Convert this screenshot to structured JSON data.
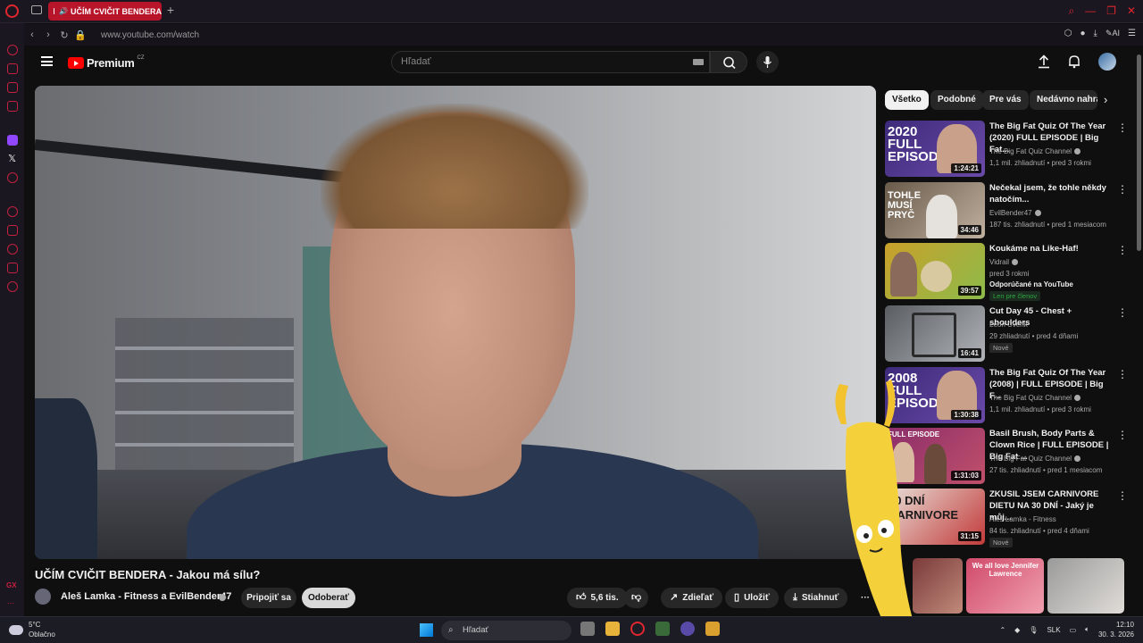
{
  "browser": {
    "tab_title": "UČÍM CVIČIT BENDERA",
    "url": "www.youtube.com/watch",
    "ai_label": "AI",
    "sidebar_more": "...",
    "sidebar_gx": "GX"
  },
  "yt_header": {
    "logo_text": "Premium",
    "logo_region": "CZ",
    "search_placeholder": "Hľadať"
  },
  "video": {
    "title": "UČÍM CVIČIT BENDERA - Jakou má sílu?",
    "channel": "Aleš Lamka - Fitness a EvilBender47",
    "join_label": "Pripojiť sa",
    "subscribe_label": "Odoberať",
    "likes": "5,6 tis.",
    "share_label": "Zdieľať",
    "save_label": "Uložiť",
    "download_label": "Stiahnuť",
    "more_label": "···"
  },
  "chips": [
    "Všetko",
    "Podobné",
    "Pre vás",
    "Nedávno nahra"
  ],
  "recommendations": [
    {
      "title": "The Big Fat Quiz Of The Year (2020) FULL EPISODE | Big Fat...",
      "channel": "The Big Fat Quiz Channel",
      "meta": "1,1 mil. zhliadnutí • pred 3 rokmi",
      "duration": "1:24:21",
      "thumb_label": "2020 FULL EPISODE",
      "thumb_color": "#3d2a7a"
    },
    {
      "title": "Nečekal jsem, že tohle někdy natočím...",
      "channel": "EvilBender47",
      "meta": "187 tis. zhliadnutí • pred 1 mesiacom",
      "duration": "34:46",
      "thumb_label": "TOHLE MUSÍ PRYČ",
      "thumb_color": "#5a4a3a"
    },
    {
      "title": "Koukáme na Like-Haf!",
      "channel": "Vidrail",
      "meta": "pred 3 rokmi",
      "note": "Odporúčané na YouTube",
      "member": "Len pre členov",
      "duration": "39:57",
      "thumb_color": "#c9a02a"
    },
    {
      "title": "Cut Day 45 - Chest + shoulders",
      "channel": "Leon Cvenk",
      "meta": "29 zhliadnutí • pred 4 dňami",
      "badge": "Nové",
      "duration": "16:41",
      "thumb_color": "#6b6e72"
    },
    {
      "title": "The Big Fat Quiz Of The Year (2008) | FULL EPISODE | Big F...",
      "channel": "The Big Fat Quiz Channel",
      "meta": "1,1 mil. zhliadnutí • pred 3 rokmi",
      "duration": "1:30:38",
      "thumb_label": "2008 FULL EPISODE",
      "thumb_color": "#3d2a7a"
    },
    {
      "title": "Basil Brush, Body Parts & Clown Rice | FULL EPISODE | Big Fat ...",
      "channel": "The Big Fat Quiz Channel",
      "meta": "27 tis. zhliadnutí • pred 1 mesiacom",
      "duration": "1:31:03",
      "thumb_label": "FULL EPISODE",
      "thumb_color": "#8a2d6a"
    },
    {
      "title": "ZKUSIL JSEM CARNIVORE DIETU NA 30 DNÍ - Jaký je můj...",
      "channel": "Aleš Lamka - Fitness",
      "meta": "84 tis. zhliadnutí • pred 4 dňami",
      "badge": "Nové",
      "duration": "31:15",
      "thumb_label": "30 DNÍ CARNIVORE",
      "thumb_color": "#c23a3a"
    }
  ],
  "bottom_thumbs": [
    {
      "color": "#7a3a3a",
      "label": ""
    },
    {
      "color": "#d04a6a",
      "label": "We all love Jennifer Lawrence"
    },
    {
      "color": "#9a9a9a",
      "label": ""
    }
  ],
  "taskbar": {
    "temp": "5°C",
    "weather": "Oblačno",
    "search_placeholder": "Hľadať",
    "lang": "SLK",
    "time": "12:10",
    "date": "30. 3. 2026"
  },
  "colors": {
    "opera_red": "#e0262e",
    "yt_red": "#ff0000",
    "bg": "#0f0f0f"
  }
}
